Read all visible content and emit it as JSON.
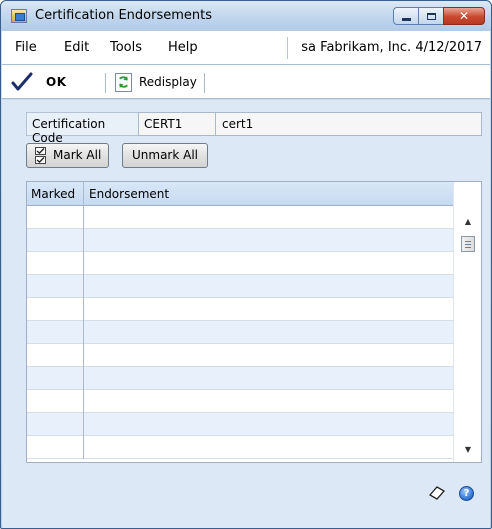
{
  "window": {
    "title": "Certification Endorsements",
    "controls": {
      "minimize_icon": "minimize-icon",
      "maximize_icon": "maximize-icon",
      "close_icon": "close-icon"
    }
  },
  "menu": {
    "items": [
      "File",
      "Edit",
      "Tools",
      "Help"
    ],
    "user": "sa",
    "company": "Fabrikam, Inc.",
    "date": "4/12/2017"
  },
  "toolbar": {
    "ok_label": "OK",
    "redisplay_label": "Redisplay"
  },
  "form": {
    "certification_code_label": "Certification Code",
    "certification_code_value": "CERT1",
    "certification_description": "cert1"
  },
  "buttons": {
    "mark_all": "Mark All",
    "unmark_all": "Unmark All"
  },
  "grid": {
    "columns": [
      "Marked",
      "Endorsement"
    ],
    "rows": [
      {
        "marked": "",
        "endorsement": ""
      },
      {
        "marked": "",
        "endorsement": ""
      },
      {
        "marked": "",
        "endorsement": ""
      },
      {
        "marked": "",
        "endorsement": ""
      },
      {
        "marked": "",
        "endorsement": ""
      },
      {
        "marked": "",
        "endorsement": ""
      },
      {
        "marked": "",
        "endorsement": ""
      },
      {
        "marked": "",
        "endorsement": ""
      },
      {
        "marked": "",
        "endorsement": ""
      },
      {
        "marked": "",
        "endorsement": ""
      },
      {
        "marked": "",
        "endorsement": ""
      }
    ]
  },
  "footer": {
    "note_icon": "note-icon",
    "help_icon": "help-icon"
  },
  "colors": {
    "titlebar": "#c2d7ee",
    "content_bg": "#dce8f5",
    "grid_header": "#c6daf1",
    "alt_row": "#e7f0fb",
    "close_button": "#c9482f"
  }
}
